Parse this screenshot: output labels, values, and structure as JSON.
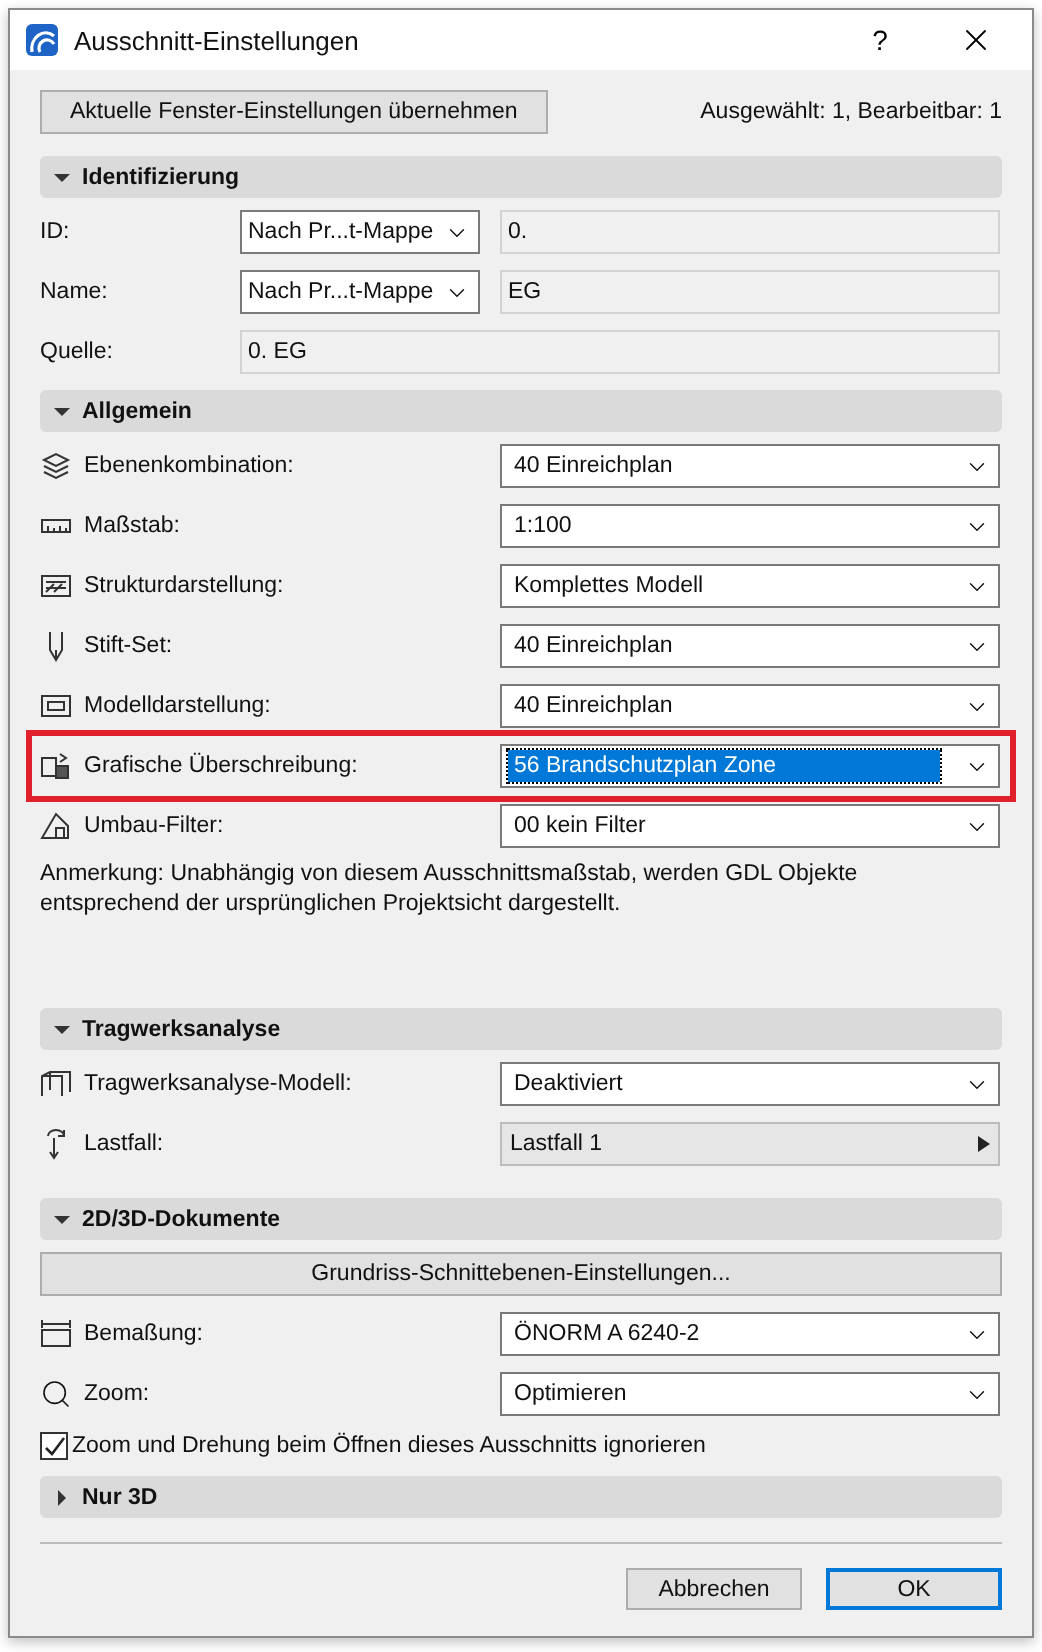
{
  "window": {
    "title": "Ausschnitt-Einstellungen",
    "help": "?"
  },
  "top_button": "Aktuelle Fenster-Einstellungen übernehmen",
  "selection_info": "Ausgewählt: 1, Bearbeitbar: 1",
  "sections": [
    {
      "title": "Identifizierung",
      "expanded": true,
      "rows": [
        {
          "kind": "split",
          "label": "ID:",
          "mode": "Nach Pr...t-Mappe",
          "value": "0."
        },
        {
          "kind": "split",
          "label": "Name:",
          "mode": "Nach Pr...t-Mappe",
          "value": "EG"
        },
        {
          "kind": "field",
          "label": "Quelle:",
          "value": "0. EG"
        }
      ]
    },
    {
      "title": "Allgemein",
      "expanded": true,
      "rows": [
        {
          "kind": "select",
          "label": "Ebenenkombination:",
          "value": "40 Einreichplan",
          "highlighted": false
        },
        {
          "kind": "select",
          "label": "Maßstab:",
          "value": "1:100",
          "highlighted": false
        },
        {
          "kind": "select",
          "label": "Strukturdarstellung:",
          "value": "Komplettes Modell",
          "highlighted": false
        },
        {
          "kind": "select",
          "label": "Stift-Set:",
          "value": "40 Einreichplan",
          "highlighted": false
        },
        {
          "kind": "select",
          "label": "Modelldarstellung:",
          "value": "40 Einreichplan",
          "highlighted": false
        },
        {
          "kind": "select",
          "label": "Grafische Überschreibung:",
          "value": "56 Brandschutzplan Zone",
          "highlighted": true
        },
        {
          "kind": "select",
          "label": "Umbau-Filter:",
          "value": "00 kein Filter",
          "highlighted": false
        },
        {
          "kind": "note",
          "text": "Anmerkung: Unabhängig von diesem Ausschnittsmaßstab, werden GDL Objekte entsprechend der ursprünglichen Projektsicht dargestellt."
        }
      ]
    },
    {
      "title": "Tragwerksanalyse",
      "expanded": true,
      "rows": [
        {
          "kind": "select",
          "label": "Tragwerksanalyse-Modell:",
          "value": "Deaktiviert",
          "highlighted": false
        },
        {
          "kind": "popup",
          "label": "Lastfall:",
          "value": "Lastfall 1"
        }
      ]
    },
    {
      "title": "2D/3D-Dokumente",
      "expanded": true,
      "rows": [
        {
          "kind": "button",
          "label": "Grundriss-Schnittebenen-Einstellungen..."
        },
        {
          "kind": "select",
          "label": "Bemaßung:",
          "value": "ÖNORM A 6240-2",
          "highlighted": false
        },
        {
          "kind": "select",
          "label": "Zoom:",
          "value": "Optimieren",
          "highlighted": false
        },
        {
          "kind": "checkbox",
          "label": "Zoom und Drehung beim Öffnen dieses Ausschnitts ignorieren",
          "checked": true
        }
      ]
    },
    {
      "title": "Nur 3D",
      "expanded": false
    }
  ],
  "buttons": [
    {
      "label": "Abbrechen",
      "default": false
    },
    {
      "label": "OK",
      "default": true
    }
  ]
}
